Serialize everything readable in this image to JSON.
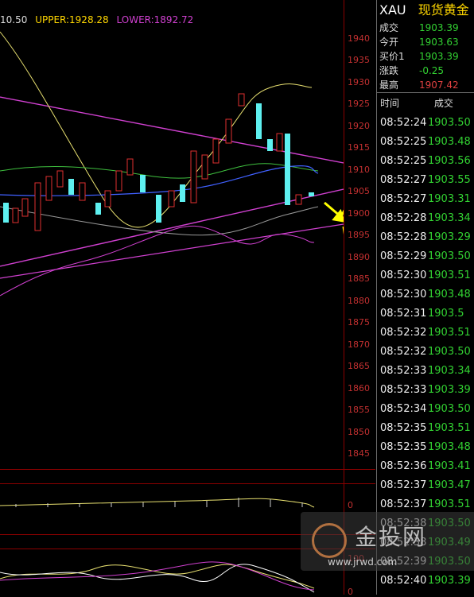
{
  "indicator": {
    "mid": "10.50",
    "upper": "UPPER:1928.28",
    "lower": "LOWER:1892.72",
    "upper_color": "#ffd700",
    "lower_color": "#d040d0"
  },
  "y_axis": {
    "labels": [
      "1940",
      "1935",
      "1930",
      "1925",
      "1920",
      "1915",
      "1910",
      "1905",
      "1900",
      "1895",
      "1890",
      "1885",
      "1880",
      "1875",
      "1870",
      "1865",
      "1860",
      "1855",
      "1850",
      "1845"
    ]
  },
  "sub_panel_labels": [
    "0",
    "100",
    "0"
  ],
  "quote": {
    "symbol": "XAU",
    "name": "现货黄金",
    "rows": [
      {
        "label": "成交",
        "value": "1903.39"
      },
      {
        "label": "今开",
        "value": "1903.63"
      },
      {
        "label": "买价1",
        "value": "1903.39"
      },
      {
        "label": "涨跌",
        "value": "-0.25"
      },
      {
        "label": "最高",
        "value": "1907.42"
      }
    ],
    "up_color": "#32d232",
    "down_color": "#e04040"
  },
  "ticks": {
    "headers": {
      "time": "时间",
      "price": "成交"
    },
    "rows": [
      {
        "time": "08:52:24",
        "price": "1903.50"
      },
      {
        "time": "08:52:25",
        "price": "1903.48"
      },
      {
        "time": "08:52:25",
        "price": "1903.56"
      },
      {
        "time": "08:52:27",
        "price": "1903.55"
      },
      {
        "time": "08:52:27",
        "price": "1903.31"
      },
      {
        "time": "08:52:28",
        "price": "1903.34"
      },
      {
        "time": "08:52:28",
        "price": "1903.29"
      },
      {
        "time": "08:52:29",
        "price": "1903.50"
      },
      {
        "time": "08:52:30",
        "price": "1903.51"
      },
      {
        "time": "08:52:30",
        "price": "1903.48"
      },
      {
        "time": "08:52:31",
        "price": "1903.5"
      },
      {
        "time": "08:52:32",
        "price": "1903.51"
      },
      {
        "time": "08:52:32",
        "price": "1903.50"
      },
      {
        "time": "08:52:33",
        "price": "1903.34"
      },
      {
        "time": "08:52:33",
        "price": "1903.39"
      },
      {
        "time": "08:52:34",
        "price": "1903.50"
      },
      {
        "time": "08:52:35",
        "price": "1903.51"
      },
      {
        "time": "08:52:35",
        "price": "1903.48"
      },
      {
        "time": "08:52:36",
        "price": "1903.41"
      },
      {
        "time": "08:52:37",
        "price": "1903.47"
      },
      {
        "time": "08:52:37",
        "price": "1903.51"
      },
      {
        "time": "08:52:38",
        "price": "1903.50"
      },
      {
        "time": "08:52:38",
        "price": "1903.49"
      },
      {
        "time": "08:52:39",
        "price": "1903.50"
      },
      {
        "time": "08:52:40",
        "price": "1903.39"
      }
    ]
  },
  "watermark": {
    "logo": "金投网",
    "url": "www.jrwd.com"
  }
}
